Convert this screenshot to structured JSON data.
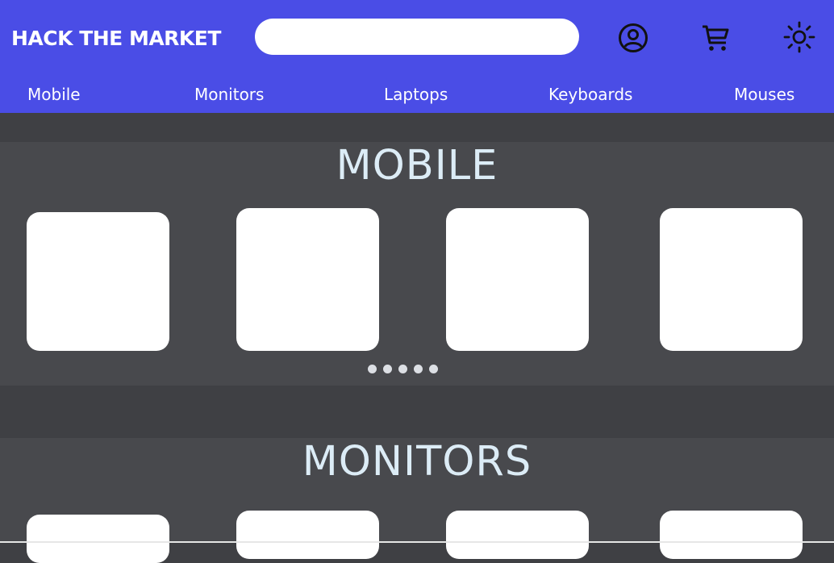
{
  "header": {
    "brand": "HACK THE MARKET",
    "search": {
      "value": "",
      "placeholder": ""
    },
    "icons": {
      "account": "user-circle-icon",
      "cart": "shopping-cart-icon",
      "theme": "sun-icon"
    }
  },
  "nav": {
    "items": [
      {
        "label": "Mobile"
      },
      {
        "label": "Monitors"
      },
      {
        "label": "Laptops"
      },
      {
        "label": "Keyboards"
      },
      {
        "label": "Mouses"
      }
    ]
  },
  "sections": [
    {
      "title": "MOBILE",
      "card_count": 4,
      "pagination_dots": 5
    },
    {
      "title": "MONITORS",
      "card_count": 4
    }
  ],
  "colors": {
    "header_bg": "#4a4de6",
    "page_bg": "#3f4044",
    "section_bg": "#48494d",
    "title_text": "#dcecf6",
    "card_bg": "#ffffff"
  }
}
